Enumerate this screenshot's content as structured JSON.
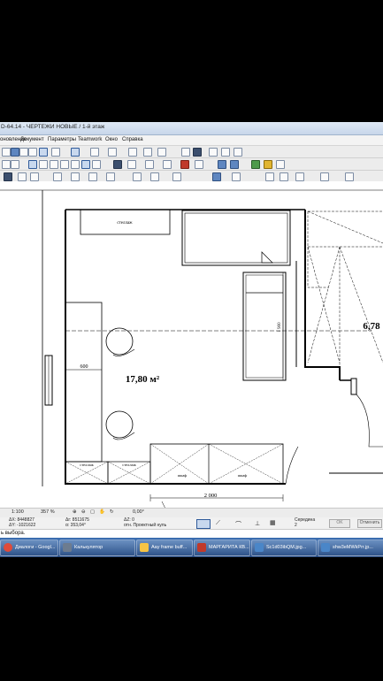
{
  "window": {
    "title": "D-64.14 - ЧЕРТЕЖИ НОВЫЕ / 1-й этаж"
  },
  "menu": {
    "items": [
      "оновление",
      "Документ",
      "Параметры",
      "Teamwork",
      "Окно",
      "Справка"
    ]
  },
  "plan": {
    "area_main": "17,80 м²",
    "area_right": "6,78",
    "dim_600": "600",
    "dim_1900": "1 900",
    "dim_2000": "2 000",
    "label_stellazh_top": "стеллаж",
    "label_stellazh_1": "стеллаж",
    "label_stellazh_2": "стеллаж",
    "label_shkaf_1": "шкаф",
    "label_shkaf_2": "шкаф"
  },
  "status": {
    "scale": "1:100",
    "zoom": "357 %",
    "angle": "0,00°"
  },
  "info": {
    "dx": "ΔX: 8448827",
    "dy": "ΔY: -1021622",
    "dr": "Δr: 8511675",
    "da": "α: 353,04°",
    "dz": "ΔZ: 0",
    "proj": "отн. Проектный нуль",
    "snap": "Середина",
    "snap_n": "2",
    "ok": "OK",
    "cancel": "Отменить"
  },
  "prompt": {
    "text": "ь выбора."
  },
  "taskbar": {
    "items": [
      {
        "label": "Диалоги - Googl...",
        "icon_color": "#e04b3a"
      },
      {
        "label": "Калькулятор",
        "icon_color": "#6d7c8f"
      },
      {
        "label": "Aay frame buff...",
        "icon_color": "#f6c445"
      },
      {
        "label": "МАРГАРИТА КВ...",
        "icon_color": "#c0392b"
      },
      {
        "label": "Sc1d03ibQM.jpg...",
        "icon_color": "#4a86c8"
      },
      {
        "label": "shw3eMWkPrr.jp...",
        "icon_color": "#4a86c8"
      }
    ]
  },
  "colors": {
    "taskbar": "#2a559a",
    "drawing": "#000000",
    "selection": "#2f5a9a"
  }
}
